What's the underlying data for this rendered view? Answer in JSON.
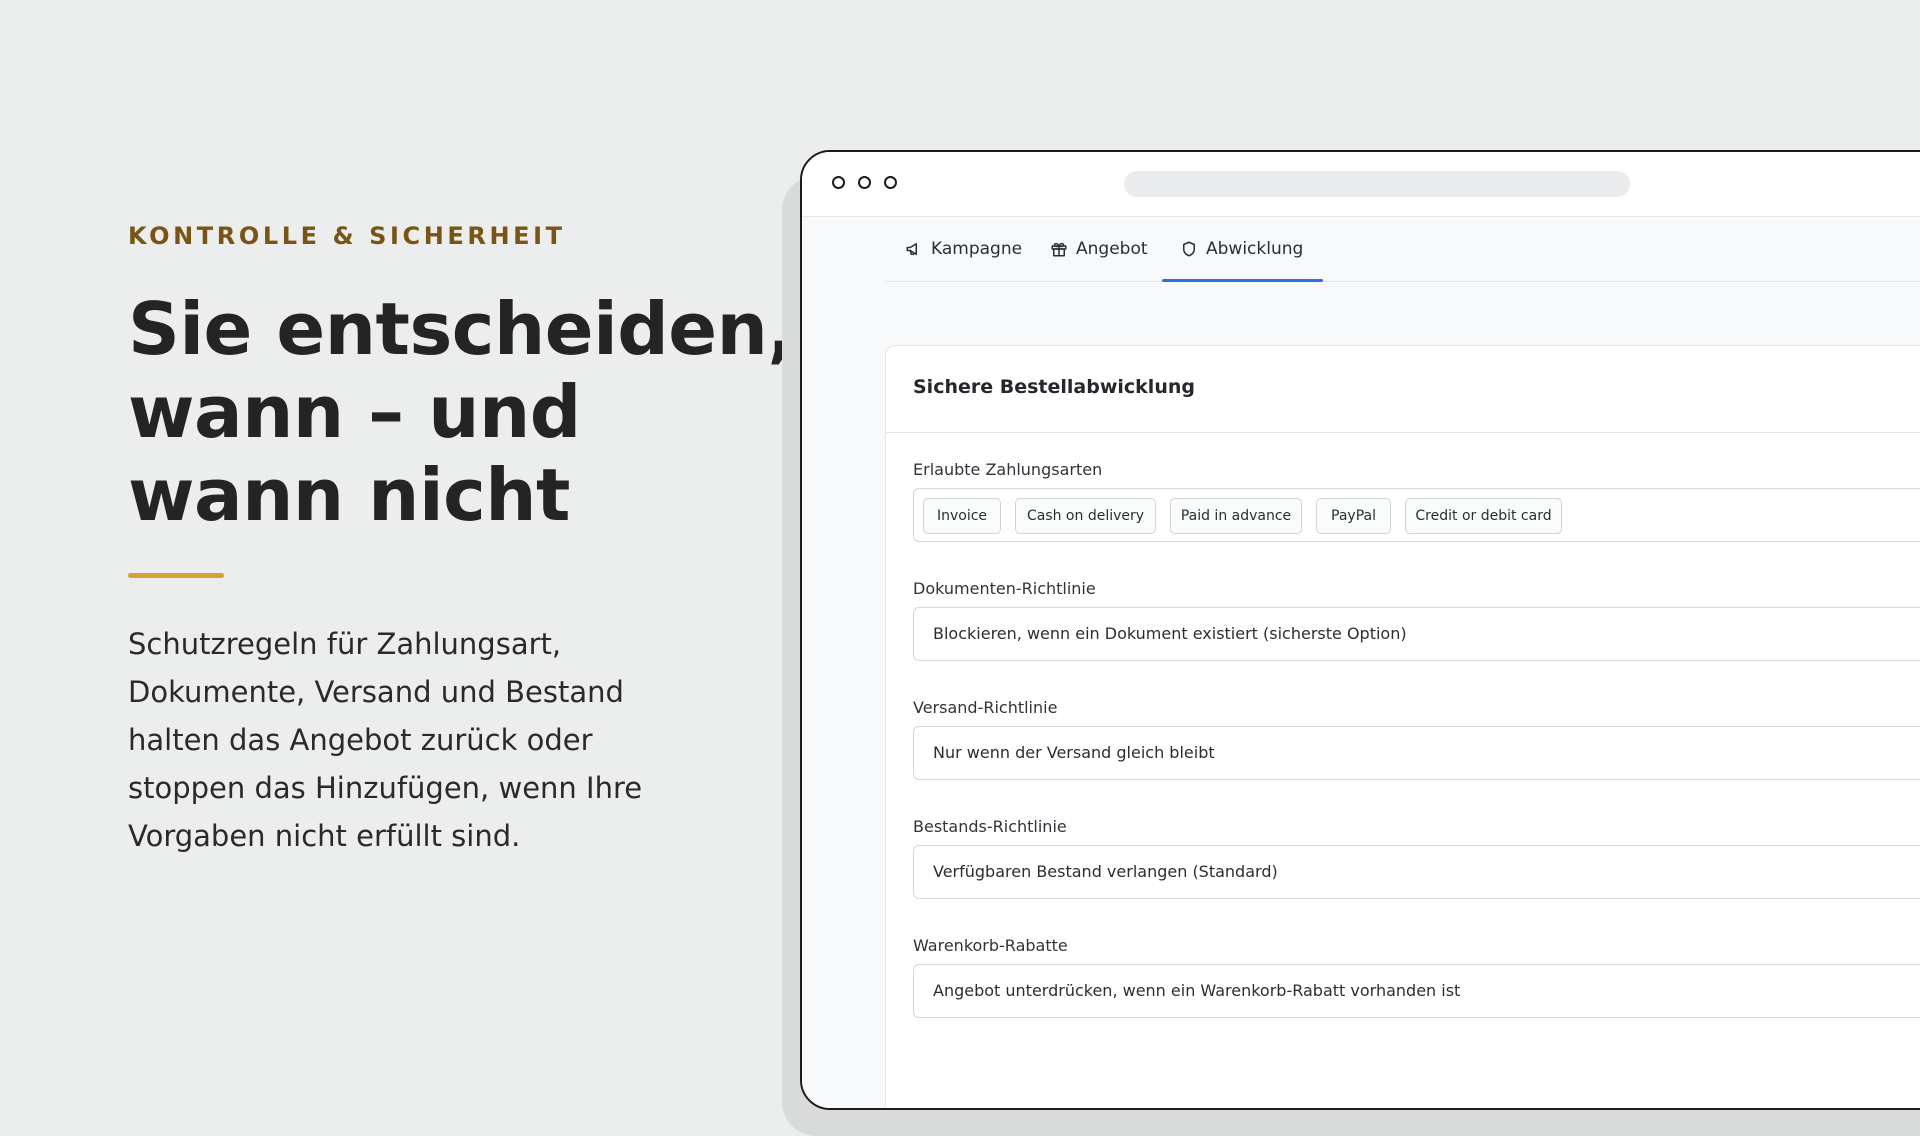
{
  "hero": {
    "eyebrow": "KONTROLLE & SICHERHEIT",
    "headline": [
      "Sie entscheiden,",
      "wann – und",
      "wann nicht"
    ],
    "accent_color": "#d4a23a",
    "body": [
      "Schutzregeln für Zahlungsart,",
      "Dokumente, Versand und Bestand",
      "halten das Angebot zurück oder",
      "stoppen das Hinzufügen, wenn Ihre",
      "Vorgaben nicht erfüllt sind."
    ]
  },
  "app": {
    "tabs": [
      {
        "label": "Kampagne",
        "icon": "megaphone-icon"
      },
      {
        "label": "Angebot",
        "icon": "gift-icon"
      },
      {
        "label": "Abwicklung",
        "icon": "shield-icon",
        "active": true
      }
    ],
    "active_tab_color": "#2f6fde",
    "card": {
      "title": "Sichere Bestellabwicklung",
      "payment_methods": {
        "label": "Erlaubte Zahlungsarten",
        "chips": [
          "Invoice",
          "Cash on delivery",
          "Paid in advance",
          "PayPal",
          "Credit or debit card"
        ]
      },
      "document_policy": {
        "label": "Dokumenten-Richtlinie",
        "value": "Blockieren, wenn ein Dokument existiert (sicherste Option)"
      },
      "shipping_policy": {
        "label": "Versand-Richtlinie",
        "value": "Nur wenn der Versand gleich bleibt"
      },
      "stock_policy": {
        "label": "Bestands-Richtlinie",
        "value": "Verfügbaren Bestand verlangen (Standard)"
      },
      "cart_discounts": {
        "label": "Warenkorb-Rabatte",
        "value": "Angebot unterdrücken, wenn ein Warenkorb-Rabatt vorhanden ist"
      }
    }
  }
}
